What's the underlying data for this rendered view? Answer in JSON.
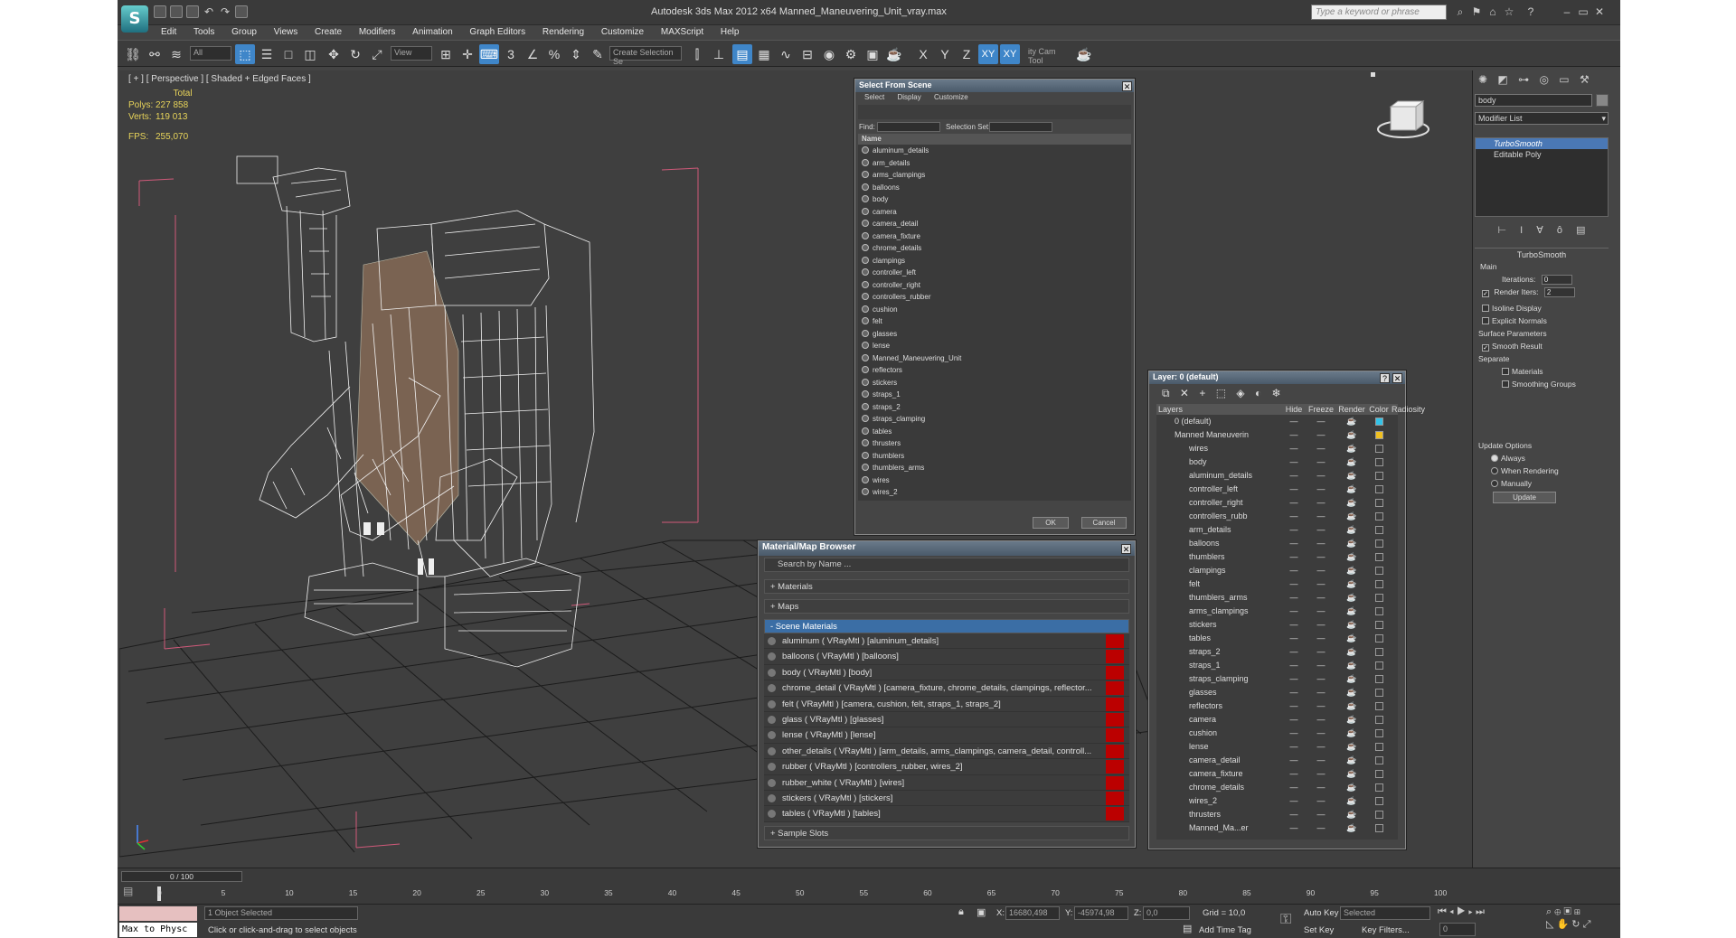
{
  "title": "Autodesk 3ds Max  2012 x64     Manned_Maneuvering_Unit_vray.max",
  "search_placeholder": "Type a keyword or phrase",
  "menu": [
    "Edit",
    "Tools",
    "Group",
    "Views",
    "Create",
    "Modifiers",
    "Animation",
    "Graph Editors",
    "Rendering",
    "Customize",
    "MAXScript",
    "Help"
  ],
  "toolbar": {
    "filter": "All",
    "view": "View",
    "selection_set": "Create Selection Se",
    "axes": [
      "X",
      "Y",
      "Z",
      "XY",
      "XY"
    ],
    "cam_tool": "ity Cam Tool"
  },
  "viewport": {
    "label": "[ + ] [ Perspective ] [ Shaded + Edged Faces ]",
    "stats": {
      "total": "Total",
      "polys_label": "Polys:",
      "polys": "227 858",
      "verts_label": "Verts:",
      "verts": "119 013",
      "fps_label": "FPS:",
      "fps": "255,070"
    }
  },
  "select_from_scene": {
    "title": "Select From Scene",
    "menus": [
      "Select",
      "Display",
      "Customize"
    ],
    "find_label": "Find:",
    "selection_set_label": "Selection Set:",
    "column": "Name",
    "items": [
      "aluminum_details",
      "arm_details",
      "arms_clampings",
      "balloons",
      "body",
      "camera",
      "camera_detail",
      "camera_fixture",
      "chrome_details",
      "clampings",
      "controller_left",
      "controller_right",
      "controllers_rubber",
      "cushion",
      "felt",
      "glasses",
      "lense",
      "Manned_Maneuvering_Unit",
      "reflectors",
      "stickers",
      "straps_1",
      "straps_2",
      "straps_clamping",
      "tables",
      "thrusters",
      "thumblers",
      "thumblers_arms",
      "wires",
      "wires_2"
    ],
    "ok": "OK",
    "cancel": "Cancel"
  },
  "material_browser": {
    "title": "Material/Map Browser",
    "search": "Search by Name ...",
    "sections": [
      "+ Materials",
      "+ Maps",
      "- Scene Materials",
      "+ Sample Slots"
    ],
    "materials": [
      "aluminum  ( VRayMtl ) [aluminum_details]",
      "balloons  ( VRayMtl ) [balloons]",
      "body  ( VRayMtl ) [body]",
      "chrome_detail  ( VRayMtl ) [camera_fixture, chrome_details, clampings, reflector...",
      "felt  ( VRayMtl ) [camera, cushion, felt, straps_1, straps_2]",
      "glass  ( VRayMtl ) [glasses]",
      "lense  ( VRayMtl ) [lense]",
      "other_details  ( VRayMtl ) [arm_details, arms_clampings, camera_detail, controll...",
      "rubber  ( VRayMtl ) [controllers_rubber, wires_2]",
      "rubber_white  ( VRayMtl ) [wires]",
      "stickers  ( VRayMtl ) [stickers]",
      "tables  ( VRayMtl ) [tables]"
    ]
  },
  "layer_dialog": {
    "title": "Layer: 0 (default)",
    "columns": [
      "Layers",
      "Hide",
      "Freeze",
      "Render",
      "Color",
      "Radiosity"
    ],
    "layers": [
      "0 (default)",
      "Manned Maneuverin"
    ],
    "objects": [
      "wires",
      "body",
      "aluminum_details",
      "controller_left",
      "controller_right",
      "controllers_rubb",
      "arm_details",
      "balloons",
      "thumblers",
      "clampings",
      "felt",
      "thumblers_arms",
      "arms_clampings",
      "stickers",
      "tables",
      "straps_2",
      "straps_1",
      "straps_clamping",
      "glasses",
      "reflectors",
      "camera",
      "cushion",
      "lense",
      "camera_detail",
      "camera_fixture",
      "chrome_details",
      "wires_2",
      "thrusters",
      "Manned_Ma...er"
    ],
    "color_default": "#33c3e8",
    "color_layer": "#f0c020"
  },
  "command_panel": {
    "name_field": "body",
    "modifier_list": "Modifier List",
    "stack": [
      "TurboSmooth",
      "Editable Poly"
    ],
    "rollout": "TurboSmooth",
    "main": "Main",
    "iterations_label": "Iterations:",
    "iterations": "0",
    "render_iters_label": "Render Iters:",
    "render_iters": "2",
    "isoline": "Isoline Display",
    "explicit": "Explicit Normals",
    "surface_params": "Surface Parameters",
    "smooth_result": "Smooth Result",
    "separate": "Separate",
    "materials": "Materials",
    "smoothing_groups": "Smoothing Groups",
    "update_options": "Update Options",
    "always": "Always",
    "when_rendering": "When Rendering",
    "manually": "Manually",
    "update": "Update"
  },
  "timeline": {
    "frame": "0 / 100",
    "ticks": [
      "0",
      "5",
      "10",
      "15",
      "20",
      "25",
      "30",
      "35",
      "40",
      "45",
      "50",
      "55",
      "60",
      "65",
      "70",
      "75",
      "80",
      "85",
      "90",
      "95",
      "100"
    ]
  },
  "status": {
    "script": "Max to Physc",
    "selected": "1 Object Selected",
    "prompt": "Click or click-and-drag to select objects",
    "x_label": "X:",
    "x": "16680,498",
    "y_label": "Y:",
    "y": "-45974,98",
    "z_label": "Z:",
    "z": "0,0",
    "grid": "Grid = 10,0",
    "add_time_tag": "Add Time Tag",
    "auto_key": "Auto Key",
    "selected_dd": "Selected",
    "set_key": "Set Key",
    "key_filters": "Key Filters...",
    "frame_field": "0"
  }
}
